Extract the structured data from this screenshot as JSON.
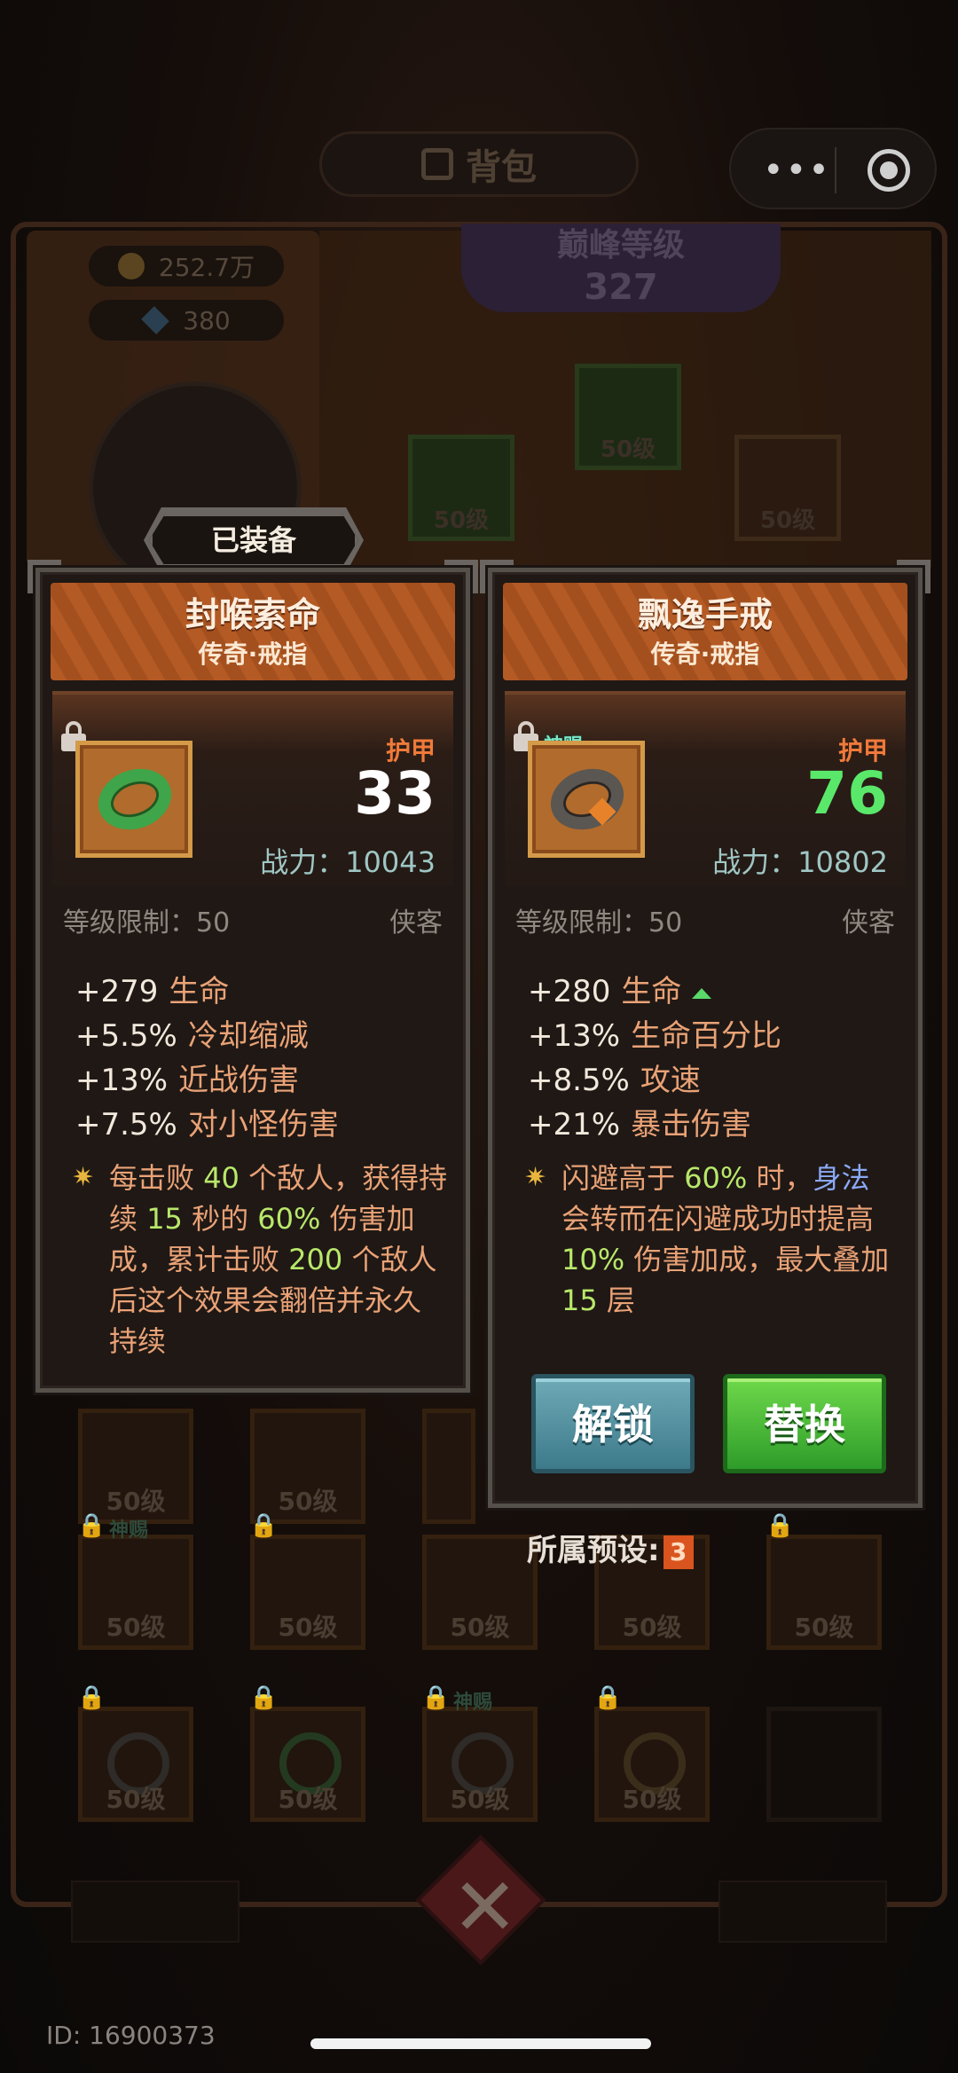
{
  "header": {
    "title": "背包",
    "menu_icon": "more-dots-icon",
    "close_icon": "target-circle-icon"
  },
  "resources": {
    "gold": "252.7万",
    "gems": "380"
  },
  "peak_level": {
    "label": "巅峰等级",
    "value": "327"
  },
  "background_slots": {
    "level_label": "50级",
    "blessed_label": "神赐"
  },
  "equipped_badge": "已装备",
  "left_card": {
    "name": "封喉索命",
    "subtitle": "传奇·戒指",
    "armor_label": "护甲",
    "armor_value": "33",
    "power_text": "战力：10043",
    "level_limit": "等级限制：50",
    "class": "侠客",
    "stats": [
      {
        "value": "+279",
        "label": "生命"
      },
      {
        "value": "+5.5%",
        "label": "冷却缩减"
      },
      {
        "value": "+13%",
        "label": "近战伤害"
      },
      {
        "value": "+7.5%",
        "label": "对小怪伤害"
      }
    ],
    "special": {
      "p1": "每击败 ",
      "n1": "40",
      "p2": " 个敌人，获得持续 ",
      "n2": "15",
      "p3": " 秒的 ",
      "n3": "60%",
      "p4": " 伤害加成，累计击败 ",
      "n4": "200",
      "p5": " 个敌人后这个效果会翻倍并永久持续"
    },
    "colors": {
      "armor_value": "#ffffff",
      "ring": "#3fa54a"
    }
  },
  "right_card": {
    "name": "飘逸手戒",
    "subtitle": "传奇·戒指",
    "blessed_badge": "神赐",
    "armor_label": "护甲",
    "armor_value": "76",
    "power_text": "战力：10802",
    "level_limit": "等级限制：50",
    "class": "侠客",
    "stats": [
      {
        "value": "+280",
        "label": "生命",
        "trend": "up"
      },
      {
        "value": "+13%",
        "label": "生命百分比"
      },
      {
        "value": "+8.5%",
        "label": "攻速"
      },
      {
        "value": "+21%",
        "label": "暴击伤害"
      }
    ],
    "special": {
      "p1": "闪避高于 ",
      "n1": "60%",
      "p2": " 时，",
      "b1": "身法",
      "p3": " 会转而在闪避成功时提高 ",
      "n2": "10%",
      "p4": " 伤害加成，最大叠加 ",
      "n3": "15",
      "p5": " 层"
    },
    "colors": {
      "armor_value": "#5ae86a",
      "ring": "#55514d"
    },
    "buttons": {
      "unlock": "解锁",
      "replace": "替换"
    }
  },
  "preset": {
    "label": "所属预设:",
    "value": "3"
  },
  "user_id": "ID: 16900373"
}
